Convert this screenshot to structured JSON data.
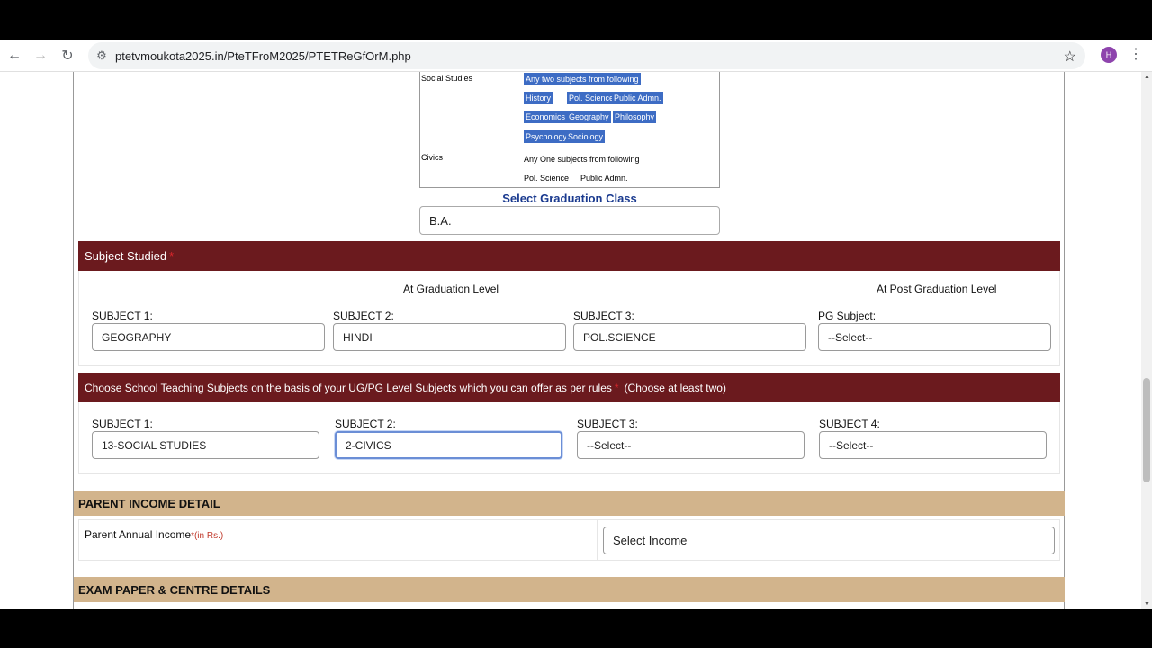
{
  "browser": {
    "url": "ptetvmoukota2025.in/PteTFroM2025/PTETReGfOrM.php",
    "profile_initial": "H"
  },
  "eligibility": {
    "social_studies_label": "Social Studies",
    "social_studies_rule": "Any two subjects from following",
    "social_subjects": [
      "History",
      "Pol. Science",
      "Public Admn.",
      "Economics",
      "Geography",
      "Philosophy",
      "Psychology",
      "Sociology"
    ],
    "civics_label": "Civics",
    "civics_rule": "Any One subjects from following",
    "civics_subjects": [
      "Pol. Science",
      "Public Admn."
    ]
  },
  "graduation": {
    "title": "Select Graduation Class",
    "value": "B.A."
  },
  "subject_studied": {
    "header": "Subject Studied",
    "required_mark": "*",
    "grad_level_label": "At Graduation Level",
    "pg_level_label": "At Post Graduation Level",
    "fields": [
      {
        "label": "SUBJECT 1:",
        "value": "GEOGRAPHY"
      },
      {
        "label": "SUBJECT 2:",
        "value": "HINDI"
      },
      {
        "label": "SUBJECT 3:",
        "value": "POL.SCIENCE"
      },
      {
        "label": "PG Subject:",
        "value": "--Select--"
      }
    ]
  },
  "teaching_subjects": {
    "header": "Choose School Teaching Subjects on the basis of your UG/PG Level Subjects which you can offer as per rules",
    "required_mark": "*",
    "note": "(Choose at least two)",
    "fields": [
      {
        "label": "SUBJECT 1:",
        "value": "13-SOCIAL STUDIES"
      },
      {
        "label": "SUBJECT 2:",
        "value": "2-CIVICS"
      },
      {
        "label": "SUBJECT 3:",
        "value": "--Select--"
      },
      {
        "label": "SUBJECT 4:",
        "value": "--Select--"
      }
    ]
  },
  "parent_income": {
    "header": "PARENT INCOME DETAIL",
    "label": "Parent Annual Income",
    "unit": "*(in Rs.)",
    "value": "Select Income"
  },
  "exam_section": {
    "header": "EXAM PAPER & CENTRE DETAILS"
  }
}
